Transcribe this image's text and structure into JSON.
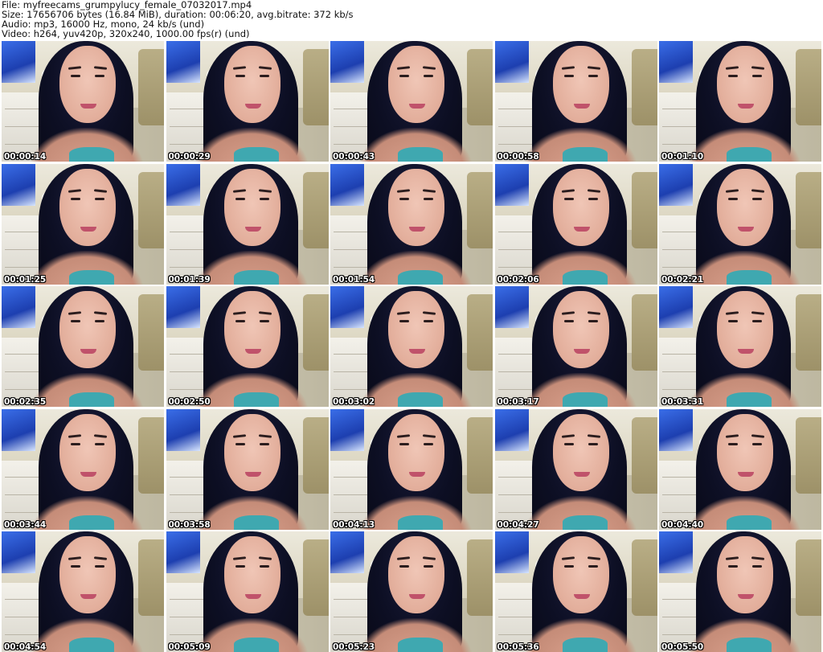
{
  "header": {
    "file": "File: myfreecams_grumpylucy_female_07032017.mp4",
    "size": "Size: 17656706 bytes (16.84 MiB), duration: 00:06:20, avg.bitrate: 372 kb/s",
    "audio": "Audio: mp3, 16000 Hz, mono, 24 kb/s (und)",
    "video": "Video: h264, yuv420p, 320x240, 1000.00 fps(r) (und)"
  },
  "thumbnails": [
    {
      "timestamp": "00:00:14"
    },
    {
      "timestamp": "00:00:29"
    },
    {
      "timestamp": "00:00:43"
    },
    {
      "timestamp": "00:00:58"
    },
    {
      "timestamp": "00:01:10"
    },
    {
      "timestamp": "00:01:25"
    },
    {
      "timestamp": "00:01:39"
    },
    {
      "timestamp": "00:01:54"
    },
    {
      "timestamp": "00:02:06"
    },
    {
      "timestamp": "00:02:21"
    },
    {
      "timestamp": "00:02:35"
    },
    {
      "timestamp": "00:02:50"
    },
    {
      "timestamp": "00:03:02"
    },
    {
      "timestamp": "00:03:17"
    },
    {
      "timestamp": "00:03:31"
    },
    {
      "timestamp": "00:03:44"
    },
    {
      "timestamp": "00:03:58"
    },
    {
      "timestamp": "00:04:13"
    },
    {
      "timestamp": "00:04:27"
    },
    {
      "timestamp": "00:04:40"
    },
    {
      "timestamp": "00:04:54"
    },
    {
      "timestamp": "00:05:09"
    },
    {
      "timestamp": "00:05:23"
    },
    {
      "timestamp": "00:05:36"
    },
    {
      "timestamp": "00:05:50"
    }
  ]
}
